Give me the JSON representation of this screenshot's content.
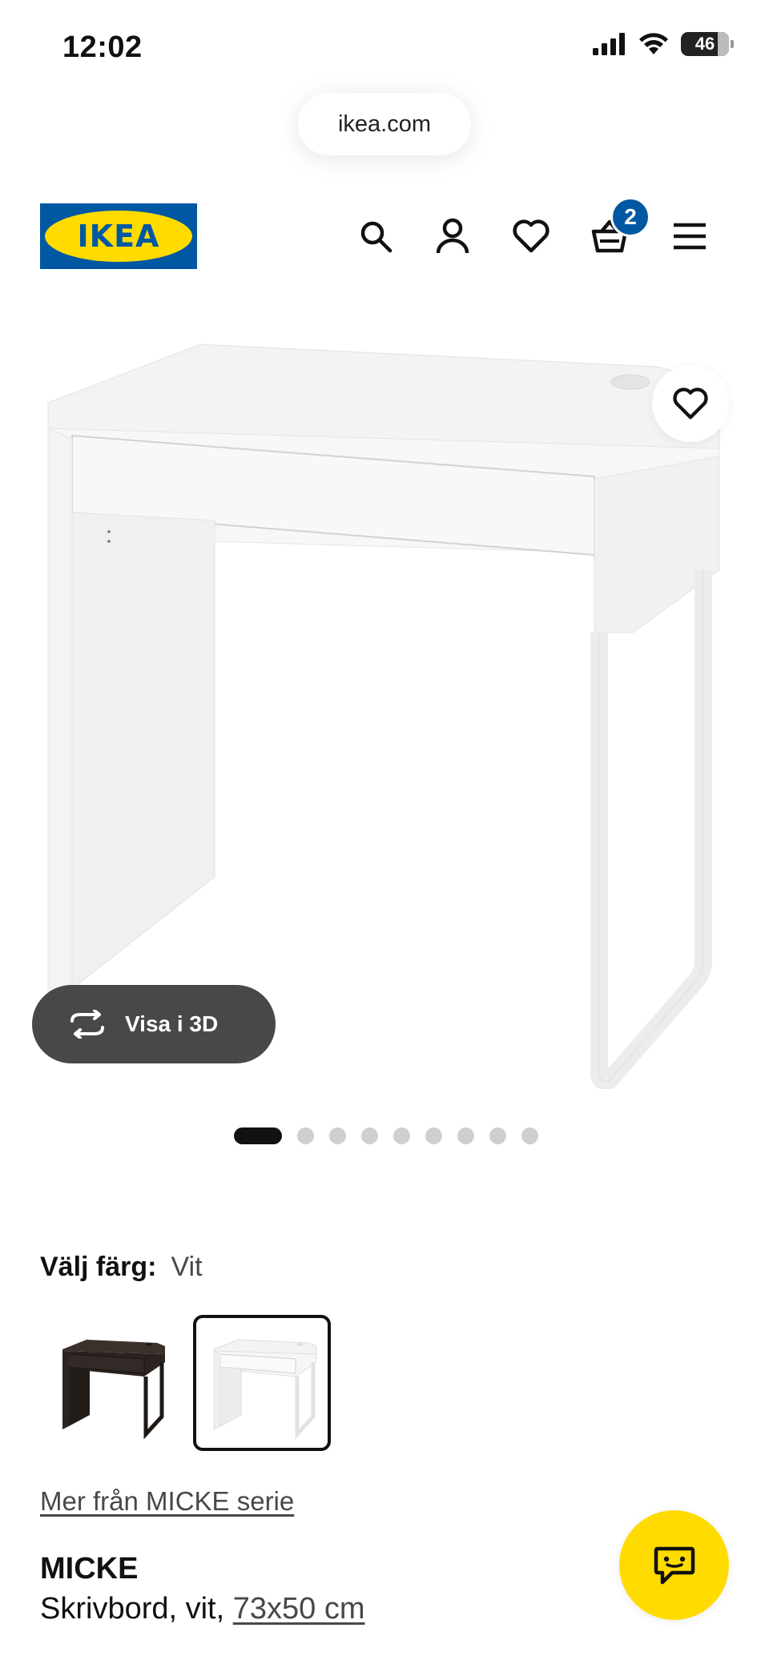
{
  "status_bar": {
    "time": "12:02",
    "battery": "46"
  },
  "browser": {
    "url": "ikea.com"
  },
  "header": {
    "logo_text": "IKEA",
    "cart_count": "2",
    "icons": [
      "search-icon",
      "account-icon",
      "heart-icon",
      "cart-icon",
      "menu-icon"
    ]
  },
  "gallery": {
    "view_3d_label": "Visa i 3D",
    "image_count": 9,
    "active_index": 0
  },
  "color_select": {
    "label": "Välj färg:",
    "value": "Vit",
    "options": [
      "black-brown",
      "white"
    ],
    "selected": 1
  },
  "product": {
    "series_link": "Mer från MICKE serie",
    "name": "MICKE",
    "description": "Skrivbord, vit,",
    "size": "73x50 cm"
  },
  "colors": {
    "ikea_blue": "#0058a3",
    "ikea_yellow": "#ffdb00",
    "pill_dark": "#484848"
  }
}
